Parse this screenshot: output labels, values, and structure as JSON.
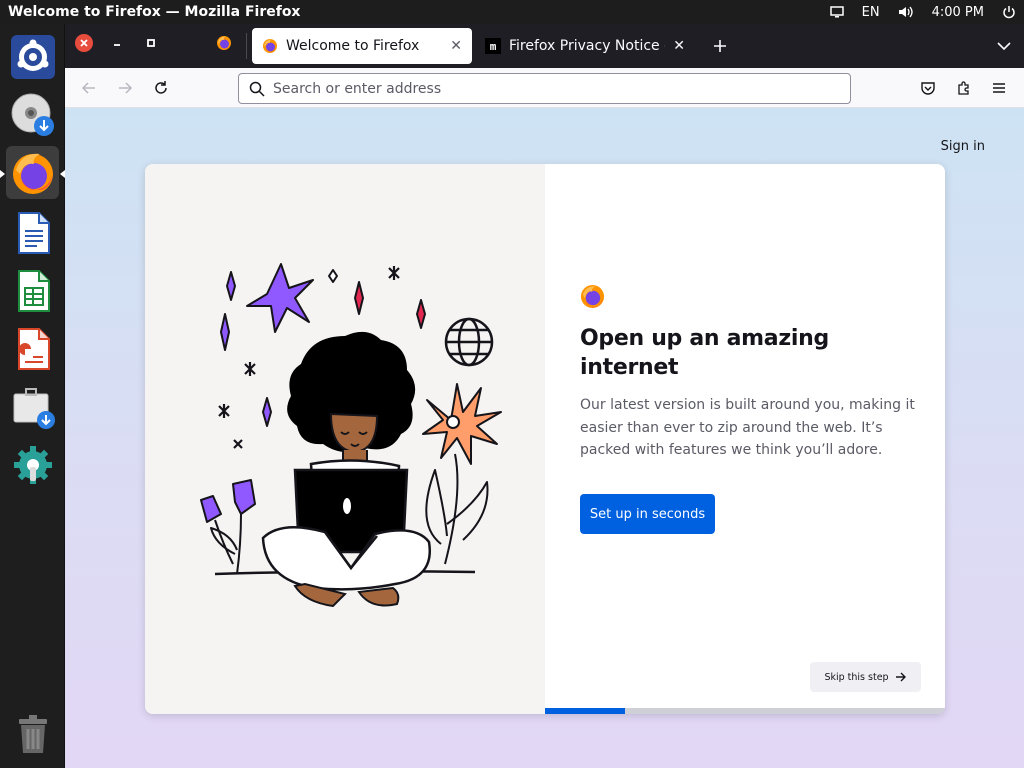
{
  "os": {
    "window_title": "Welcome to Firefox — Mozilla Firefox",
    "language": "EN",
    "clock": "4:00 PM"
  },
  "dock": {
    "items": [
      "ubuntu-software-icon",
      "dvd-install-icon",
      "firefox-icon",
      "writer-icon",
      "calc-icon",
      "impress-icon",
      "installer-icon",
      "settings-icon",
      "trash-icon"
    ]
  },
  "tabs": [
    {
      "title": "Welcome to Firefox",
      "selected": true
    },
    {
      "title": "Firefox Privacy Notice —",
      "selected": false
    }
  ],
  "urlbar": {
    "placeholder": "Search or enter address"
  },
  "page": {
    "sign_in": "Sign in",
    "headline": "Open up an amazing internet",
    "subtext": "Our latest version is built around you, making it easier than ever to zip around the web. It’s packed with features we think you’ll adore.",
    "cta": "Set up in seconds",
    "skip": "Skip this step",
    "progress": 0.2
  },
  "colors": {
    "accent": "#0061e0",
    "tab_strip": "#1f1e25",
    "close_red": "#e74c3c"
  }
}
